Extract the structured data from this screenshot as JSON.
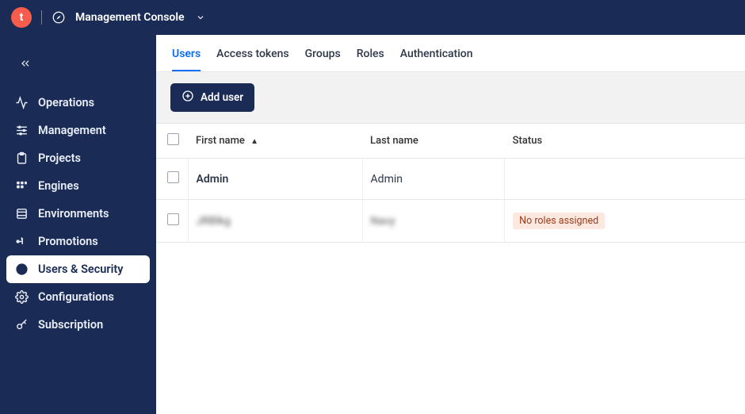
{
  "brand_letter": "t",
  "header": {
    "title": "Management Console"
  },
  "sidebar": {
    "items": [
      {
        "label": "Operations"
      },
      {
        "label": "Management"
      },
      {
        "label": "Projects"
      },
      {
        "label": "Engines"
      },
      {
        "label": "Environments"
      },
      {
        "label": "Promotions"
      },
      {
        "label": "Users & Security"
      },
      {
        "label": "Configurations"
      },
      {
        "label": "Subscription"
      }
    ]
  },
  "tabs": [
    {
      "label": "Users"
    },
    {
      "label": "Access tokens"
    },
    {
      "label": "Groups"
    },
    {
      "label": "Roles"
    },
    {
      "label": "Authentication"
    }
  ],
  "actions": {
    "add_user": "Add user"
  },
  "table": {
    "columns": {
      "first_name": "First name",
      "last_name": "Last name",
      "status": "Status"
    },
    "rows": [
      {
        "first_name": "Admin",
        "last_name": "Admin",
        "status": ""
      },
      {
        "first_name": "JRBlkg",
        "last_name": "Navy",
        "status": "No roles assigned"
      }
    ]
  }
}
